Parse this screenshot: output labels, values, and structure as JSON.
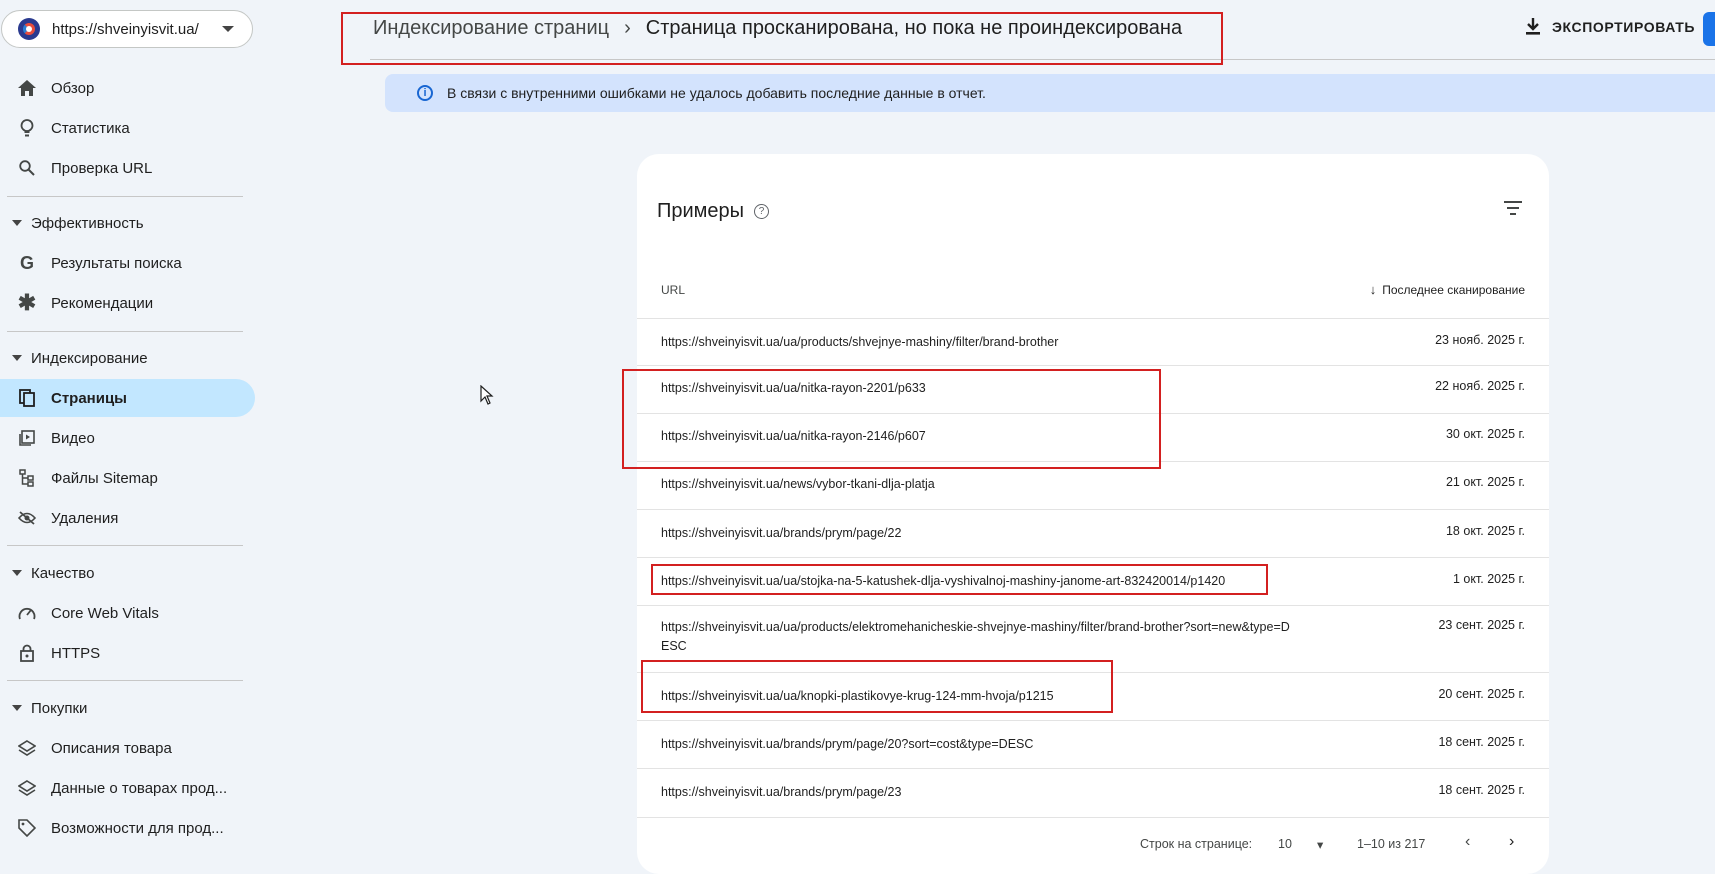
{
  "property": {
    "url": "https://shveinyisvit.ua/"
  },
  "sidebar": {
    "top_items": [
      {
        "label": "Обзор",
        "icon": "home-icon"
      },
      {
        "label": "Статистика",
        "icon": "lightbulb-icon"
      },
      {
        "label": "Проверка URL",
        "icon": "search-icon"
      }
    ],
    "sections": [
      {
        "label": "Эффективность",
        "items": [
          {
            "label": "Результаты поиска",
            "icon": "google-g-icon"
          },
          {
            "label": "Рекомендации",
            "icon": "asterisk-icon"
          }
        ]
      },
      {
        "label": "Индексирование",
        "items": [
          {
            "label": "Страницы",
            "icon": "pages-icon",
            "active": true
          },
          {
            "label": "Видео",
            "icon": "video-icon"
          },
          {
            "label": "Файлы Sitemap",
            "icon": "sitemap-icon"
          },
          {
            "label": "Удаления",
            "icon": "eye-off-icon"
          }
        ]
      },
      {
        "label": "Качество",
        "items": [
          {
            "label": "Core Web Vitals",
            "icon": "speed-icon"
          },
          {
            "label": "HTTPS",
            "icon": "lock-icon"
          }
        ]
      },
      {
        "label": "Покупки",
        "items": [
          {
            "label": "Описания товара",
            "icon": "layers-icon"
          },
          {
            "label": "Данные о товарах прод...",
            "icon": "layers-icon"
          },
          {
            "label": "Возможности для прод...",
            "icon": "tag-icon"
          }
        ]
      }
    ]
  },
  "header": {
    "breadcrumb_parent": "Индексирование страниц",
    "breadcrumb_current": "Страница просканирована, но пока не проиндексирована",
    "export_label": "ЭКСПОРТИРОВАТЬ"
  },
  "banner": {
    "text": "В связи с внутренними ошибками не удалось добавить последние данные в отчет."
  },
  "examples": {
    "title": "Примеры",
    "col_url": "URL",
    "col_date": "Последнее сканирование",
    "rows": [
      {
        "url": "https://shveinyisvit.ua/ua/products/shvejnye-mashiny/filter/brand-brother",
        "date": "23 нояб. 2025 г."
      },
      {
        "url": "https://shveinyisvit.ua/ua/nitka-rayon-2201/p633",
        "date": "22 нояб. 2025 г."
      },
      {
        "url": "https://shveinyisvit.ua/ua/nitka-rayon-2146/p607",
        "date": "30 окт. 2025 г."
      },
      {
        "url": "https://shveinyisvit.ua/news/vybor-tkani-dlja-platja",
        "date": "21 окт. 2025 г."
      },
      {
        "url": "https://shveinyisvit.ua/brands/prym/page/22",
        "date": "18 окт. 2025 г."
      },
      {
        "url": "https://shveinyisvit.ua/ua/stojka-na-5-katushek-dlja-vyshivalnoj-mashiny-janome-art-832420014/p1420",
        "date": "1 окт. 2025 г."
      },
      {
        "url": "https://shveinyisvit.ua/ua/products/elektromehanicheskie-shvejnye-mashiny/filter/brand-brother?sort=new&type=DESC",
        "date": "23 сент. 2025 г."
      },
      {
        "url": "https://shveinyisvit.ua/ua/knopki-plastikovye-krug-124-mm-hvoja/p1215",
        "date": "20 сент. 2025 г."
      },
      {
        "url": "https://shveinyisvit.ua/brands/prym/page/20?sort=cost&type=DESC",
        "date": "18 сент. 2025 г."
      },
      {
        "url": "https://shveinyisvit.ua/brands/prym/page/23",
        "date": "18 сент. 2025 г."
      }
    ],
    "pager": {
      "rows_label": "Строк на странице:",
      "rows_value": "10",
      "range": "1–10 из 217"
    }
  }
}
